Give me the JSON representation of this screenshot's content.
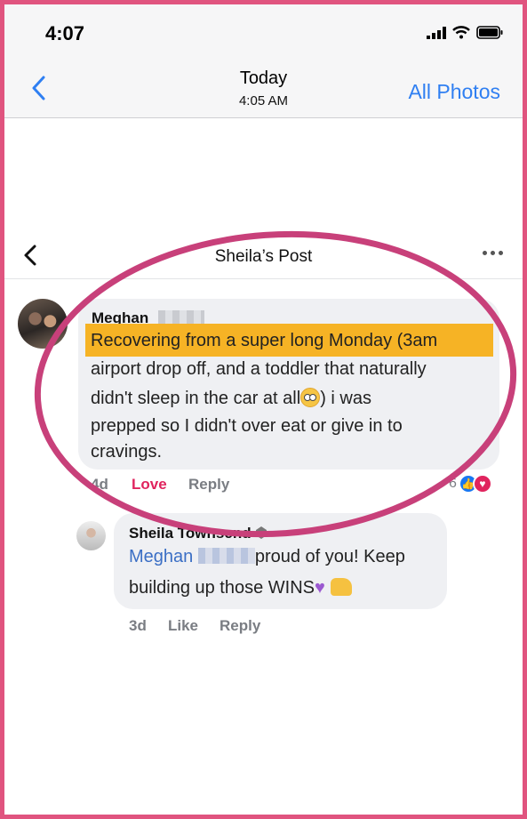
{
  "status_bar": {
    "time": "4:07"
  },
  "photo_nav": {
    "title": "Today",
    "subtitle": "4:05 AM",
    "right_link": "All Photos"
  },
  "post_header": {
    "title": "Sheila’s Post"
  },
  "comment": {
    "author": "Meghan",
    "lines": [
      "Recovering from a super long Monday (3am",
      "airport drop off, and a toddler that naturally",
      "didn't sleep in the car at all",
      ")  i was",
      "prepped so I didn't over eat or give in to",
      "cravings."
    ],
    "time": "4d",
    "reaction_label": "Love",
    "reply_label": "Reply",
    "reaction_count": "6"
  },
  "reply": {
    "author": "Sheila Townsend",
    "mention": "Meghan",
    "text_a": "proud of you! Keep",
    "text_b": "building up those WINS",
    "time": "3d",
    "like_label": "Like",
    "reply_label": "Reply"
  },
  "colors": {
    "frame": "#e0547f",
    "highlight": "#f6b325",
    "link": "#2f7ff2",
    "mention": "#3b6fc5",
    "love": "#e0245e"
  }
}
